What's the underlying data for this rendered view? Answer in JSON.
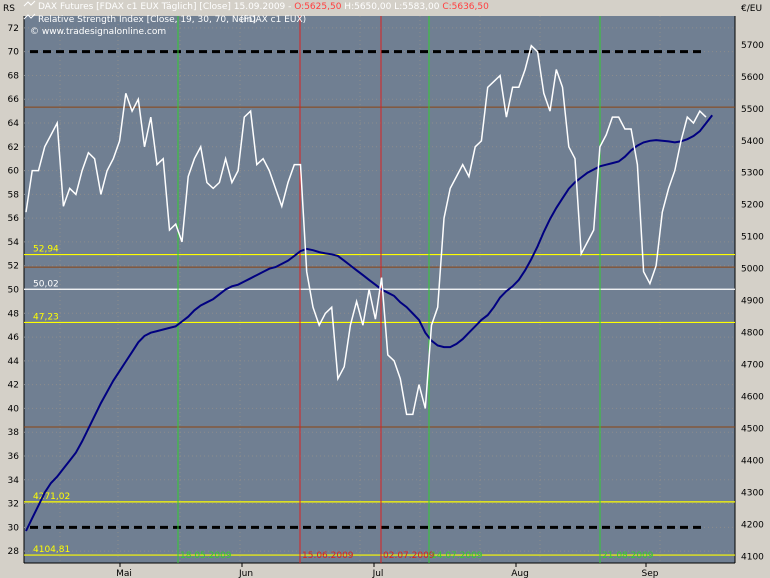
{
  "legend": {
    "line1_instrument": "DAX Futures [FDAX c1 EUX  Täglich] [Close]",
    "line1_date": "15.09.2009",
    "line1_open": "O:5625,50",
    "line1_high": "H:5650,00",
    "line1_low": "L:5583,00",
    "line1_close": "C:5636,50",
    "line2": "Relative Strength Index [Close, 19, 30, 70, Nein]",
    "line2_tail": "(FDAX c1 EUX)",
    "source": "© www.tradesignalonline.com"
  },
  "axis_units": {
    "left": "RS",
    "right": "€/EU"
  },
  "colors": {
    "background": "#707f92",
    "rsi": "#ffffff",
    "price": "#000080",
    "grid": "#8c8c8c",
    "green_line": "#32cd32",
    "red_line": "#dc2020",
    "yellow_level": "#ffff00",
    "white_level": "#ffffff",
    "brown_level": "#8b4513",
    "dashed_level": "#000000"
  },
  "chart_data": {
    "type": "line",
    "x_categories": [
      "Mai",
      "Jun",
      "Jul",
      "Aug",
      "Sep"
    ],
    "left_ylim": [
      27,
      73
    ],
    "left_ticks": [
      28,
      30,
      32,
      34,
      36,
      38,
      40,
      42,
      44,
      46,
      48,
      50,
      52,
      54,
      56,
      58,
      60,
      62,
      64,
      66,
      68,
      70,
      72
    ],
    "right_ylim": [
      4080,
      5790
    ],
    "right_ticks": [
      4100,
      4200,
      4300,
      4400,
      4500,
      4600,
      4700,
      4800,
      4900,
      5000,
      5100,
      5200,
      5300,
      5400,
      5500,
      5600,
      5700
    ],
    "series": [
      {
        "name": "Relative Strength Index",
        "axis": "left",
        "values": [
          56.5,
          60.0,
          60.0,
          62.0,
          63.0,
          64.0,
          57.0,
          58.5,
          58.0,
          60.0,
          61.5,
          61.0,
          58.0,
          60.0,
          61.0,
          62.5,
          66.5,
          65.0,
          66.0,
          62.0,
          64.5,
          60.5,
          61.0,
          55.0,
          55.5,
          54.0,
          59.5,
          61.0,
          62.0,
          59.0,
          58.5,
          59.0,
          61.0,
          59.0,
          60.0,
          64.5,
          65.0,
          60.5,
          61.0,
          60.0,
          58.5,
          57.0,
          59.0,
          60.5,
          60.5,
          51.5,
          48.5,
          47.0,
          48.0,
          48.5,
          42.5,
          43.5,
          47.0,
          49.0,
          47.0,
          50.0,
          47.5,
          51.0,
          44.5,
          44.0,
          42.5,
          39.5,
          39.5,
          42.0,
          40.0,
          47.0,
          48.5,
          56.0,
          58.5,
          59.5,
          60.5,
          59.5,
          62.0,
          62.5,
          67.0,
          67.5,
          68.0,
          64.5,
          67.0,
          67.0,
          68.5,
          70.5,
          70.0,
          66.5,
          65.0,
          68.5,
          67.0,
          62.0,
          61.0,
          53.0,
          54.0,
          55.0,
          62.0,
          63.0,
          64.5,
          64.5,
          63.5,
          63.5,
          60.5,
          51.5,
          50.5,
          52.0,
          56.5,
          58.5,
          60.0,
          62.5,
          64.5,
          64.0,
          65.0,
          64.5
        ]
      },
      {
        "name": "DAX Futures",
        "axis": "right",
        "values": [
          4180,
          4220,
          4260,
          4300,
          4330,
          4350,
          4375,
          4400,
          4425,
          4460,
          4500,
          4540,
          4580,
          4615,
          4650,
          4680,
          4710,
          4740,
          4770,
          4790,
          4800,
          4805,
          4810,
          4815,
          4820,
          4835,
          4850,
          4870,
          4885,
          4895,
          4905,
          4920,
          4935,
          4945,
          4950,
          4960,
          4970,
          4980,
          4990,
          5000,
          5005,
          5015,
          5025,
          5040,
          5055,
          5062,
          5058,
          5052,
          5048,
          5045,
          5040,
          5025,
          5010,
          4995,
          4980,
          4965,
          4950,
          4935,
          4925,
          4915,
          4895,
          4880,
          4860,
          4840,
          4800,
          4775,
          4760,
          4755,
          4755,
          4765,
          4780,
          4800,
          4820,
          4840,
          4855,
          4880,
          4910,
          4930,
          4945,
          4965,
          4995,
          5030,
          5070,
          5115,
          5155,
          5190,
          5220,
          5250,
          5270,
          5285,
          5300,
          5310,
          5320,
          5325,
          5330,
          5335,
          5350,
          5370,
          5385,
          5395,
          5400,
          5402,
          5400,
          5398,
          5395,
          5398,
          5405,
          5415,
          5430,
          5455,
          5480
        ]
      }
    ],
    "horizontal_levels": [
      {
        "label": "52,94",
        "rsi": 52.94,
        "color": "yellow"
      },
      {
        "label": "50,02",
        "rsi": 50.02,
        "color": "white"
      },
      {
        "label": "47,23",
        "rsi": 47.23,
        "color": "yellow"
      },
      {
        "label": "4271,02",
        "price": 4271.02,
        "color": "yellow"
      },
      {
        "label": "4104,81",
        "price": 4104.81,
        "color": "yellow"
      },
      {
        "label": "",
        "rsi": 70,
        "color": "black-dashed"
      },
      {
        "label": "",
        "rsi": 30,
        "color": "black-dashed"
      },
      {
        "label": "",
        "price": 5505,
        "color": "brown"
      },
      {
        "label": "",
        "price": 5005,
        "color": "brown"
      },
      {
        "label": "",
        "price": 4505,
        "color": "brown"
      }
    ],
    "vertical_markers": [
      {
        "label": "18.05.2009",
        "color": "green"
      },
      {
        "label": "15.06.2009",
        "color": "red"
      },
      {
        "label": "02.07.2009",
        "color": "red"
      },
      {
        "label": "14.07.2009",
        "color": "green"
      },
      {
        "label": "21.08.2009",
        "color": "green"
      }
    ],
    "grid": true
  }
}
